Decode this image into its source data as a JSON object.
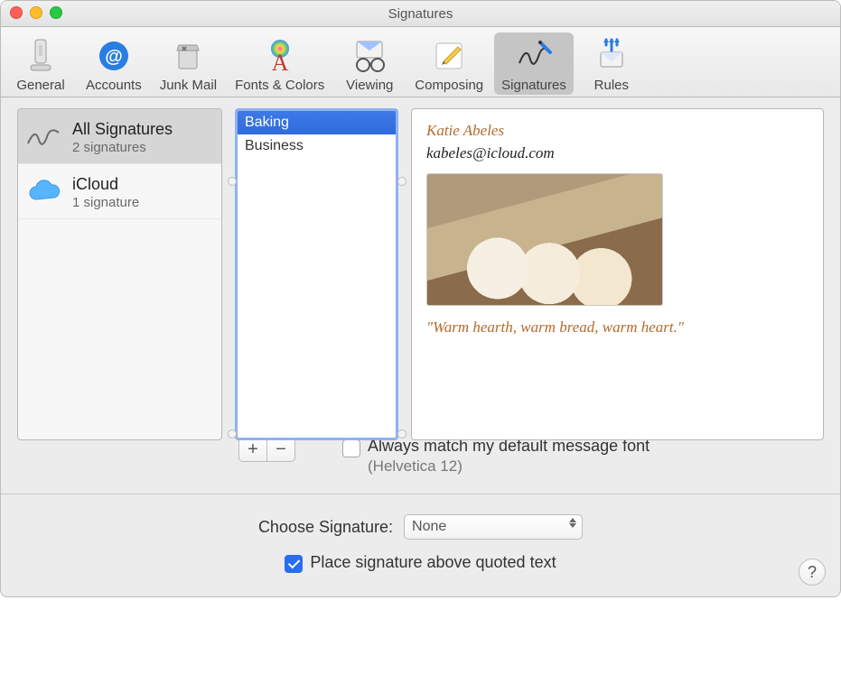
{
  "window_title": "Signatures",
  "toolbar": [
    {
      "id": "general",
      "label": "General"
    },
    {
      "id": "accounts",
      "label": "Accounts"
    },
    {
      "id": "junk",
      "label": "Junk Mail"
    },
    {
      "id": "fonts",
      "label": "Fonts & Colors"
    },
    {
      "id": "viewing",
      "label": "Viewing"
    },
    {
      "id": "composing",
      "label": "Composing"
    },
    {
      "id": "signatures",
      "label": "Signatures",
      "active": true
    },
    {
      "id": "rules",
      "label": "Rules"
    }
  ],
  "accounts": [
    {
      "name": "All Signatures",
      "subtitle": "2 signatures",
      "icon": "signature-icon",
      "selected": true
    },
    {
      "name": "iCloud",
      "subtitle": "1 signature",
      "icon": "icloud-icon",
      "selected": false
    }
  ],
  "signatures": [
    {
      "name": "Baking",
      "selected": true
    },
    {
      "name": "Business",
      "selected": false
    }
  ],
  "preview": {
    "display_name": "Katie Abeles",
    "email": "kabeles@icloud.com",
    "quote": "\"Warm hearth, warm bread, warm heart.\""
  },
  "match_font": {
    "checked": false,
    "label": "Always match my default message font",
    "detail": "(Helvetica 12)"
  },
  "choose_signature": {
    "label": "Choose Signature:",
    "value": "None"
  },
  "place_above": {
    "checked": true,
    "label": "Place signature above quoted text"
  },
  "buttons": {
    "add": "+",
    "remove": "−"
  }
}
